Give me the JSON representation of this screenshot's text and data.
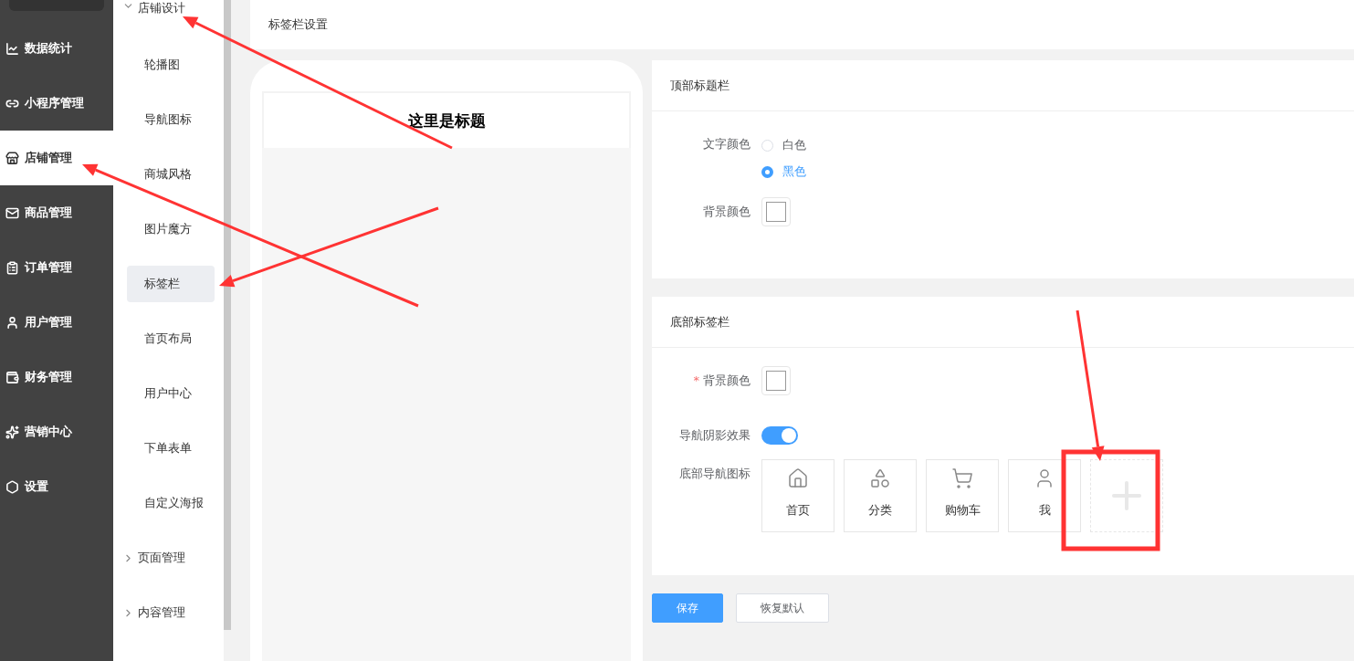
{
  "sidebar": {
    "items": [
      {
        "label": "数据统计",
        "selected": false
      },
      {
        "label": "小程序管理",
        "selected": false
      },
      {
        "label": "店铺管理",
        "selected": true
      },
      {
        "label": "商品管理",
        "selected": false
      },
      {
        "label": "订单管理",
        "selected": false
      },
      {
        "label": "用户管理",
        "selected": false
      },
      {
        "label": "财务管理",
        "selected": false
      },
      {
        "label": "营销中心",
        "selected": false
      },
      {
        "label": "设置",
        "selected": false
      }
    ]
  },
  "submenu": {
    "groups": [
      {
        "label": "店铺设计",
        "expanded": true,
        "children": [
          {
            "label": "轮播图",
            "selected": false
          },
          {
            "label": "导航图标",
            "selected": false
          },
          {
            "label": "商城风格",
            "selected": false
          },
          {
            "label": "图片魔方",
            "selected": false
          },
          {
            "label": "标签栏",
            "selected": true
          },
          {
            "label": "首页布局",
            "selected": false
          },
          {
            "label": "用户中心",
            "selected": false
          },
          {
            "label": "下单表单",
            "selected": false
          },
          {
            "label": "自定义海报",
            "selected": false
          }
        ]
      },
      {
        "label": "页面管理",
        "expanded": false
      },
      {
        "label": "内容管理",
        "expanded": false
      }
    ]
  },
  "page_title": "标签栏设置",
  "preview": {
    "title": "这里是标题"
  },
  "top_bar_panel": {
    "heading": "顶部标题栏",
    "text_color": {
      "label": "文字颜色",
      "options": [
        {
          "label": "白色",
          "selected": false
        },
        {
          "label": "黑色",
          "selected": true
        }
      ]
    },
    "background_color": {
      "label": "背景颜色"
    }
  },
  "bottom_bar_panel": {
    "heading": "底部标签栏",
    "background_color": {
      "label": "背景颜色",
      "required_mark": "*"
    },
    "shadow": {
      "label": "导航阴影效果",
      "on": true
    },
    "nav_icons": {
      "label": "底部导航图标",
      "items": [
        {
          "label": "首页"
        },
        {
          "label": "分类"
        },
        {
          "label": "购物车"
        },
        {
          "label": "我"
        }
      ]
    }
  },
  "buttons": [
    {
      "label": "保存",
      "kind": "primary"
    },
    {
      "label": "恢复默认",
      "kind": "default"
    }
  ]
}
